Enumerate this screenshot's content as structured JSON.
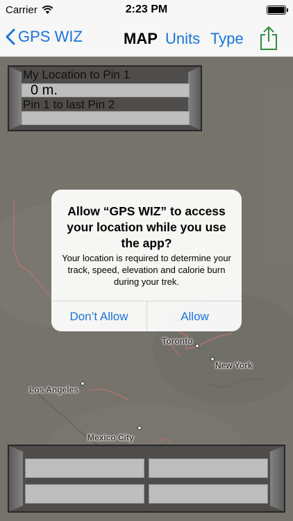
{
  "status_bar": {
    "carrier": "Carrier",
    "time": "2:23 PM"
  },
  "nav": {
    "back_label": "GPS WIZ",
    "title": "MAP",
    "units_label": "Units",
    "type_label": "Type"
  },
  "info_panel": {
    "label1": "My Location to Pin 1",
    "value1": "0 m.",
    "label2": "Pin 1 to last Pin 2",
    "value2": ""
  },
  "map": {
    "cities": [
      {
        "name": "Toronto"
      },
      {
        "name": "New York"
      },
      {
        "name": "Los Angeles"
      },
      {
        "name": "Mexico City"
      }
    ]
  },
  "alert": {
    "title": "Allow “GPS WIZ” to access your location while you use the app?",
    "message": "Your location is required to determine your track, speed, elevation and calorie burn during your trek.",
    "deny_label": "Don’t Allow",
    "allow_label": "Allow"
  },
  "colors": {
    "accent": "#1a73d8",
    "share_icon": "#2e8b3a",
    "border_line": "#c07a78"
  }
}
